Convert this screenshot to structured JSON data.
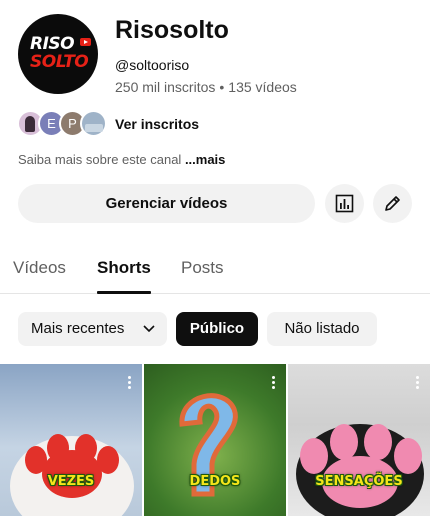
{
  "channel": {
    "logo_top": "RISO",
    "logo_bottom": "SOLTO",
    "name": "Risosolto",
    "handle": "@soltooriso",
    "subscribers": "250 mil inscritos",
    "separator": "•",
    "videos_count": "135 vídeos"
  },
  "subscribers_row": {
    "avatars": [
      "",
      "E",
      "P",
      ""
    ],
    "link": "Ver inscritos"
  },
  "about": {
    "text": "Saiba mais sobre este canal",
    "more": "...mais"
  },
  "actions": {
    "manage_label": "Gerenciar vídeos",
    "stats_icon": "bar-chart-icon",
    "edit_icon": "pencil-icon"
  },
  "tabs": [
    {
      "label": "Vídeos",
      "active": false
    },
    {
      "label": "Shorts",
      "active": true
    },
    {
      "label": "Posts",
      "active": false
    }
  ],
  "filters": {
    "sort_label": "Mais recentes",
    "public_label": "Público",
    "unlisted_label": "Não listado"
  },
  "shorts": [
    {
      "caption": "VEZES"
    },
    {
      "caption": "DEDOS"
    },
    {
      "caption": "SENSAÇÕES"
    }
  ],
  "colors": {
    "accent_dark": "#0f0f0f",
    "chip_bg": "#f2f2f2",
    "secondary_text": "#606060",
    "brand_red": "#e62117"
  }
}
